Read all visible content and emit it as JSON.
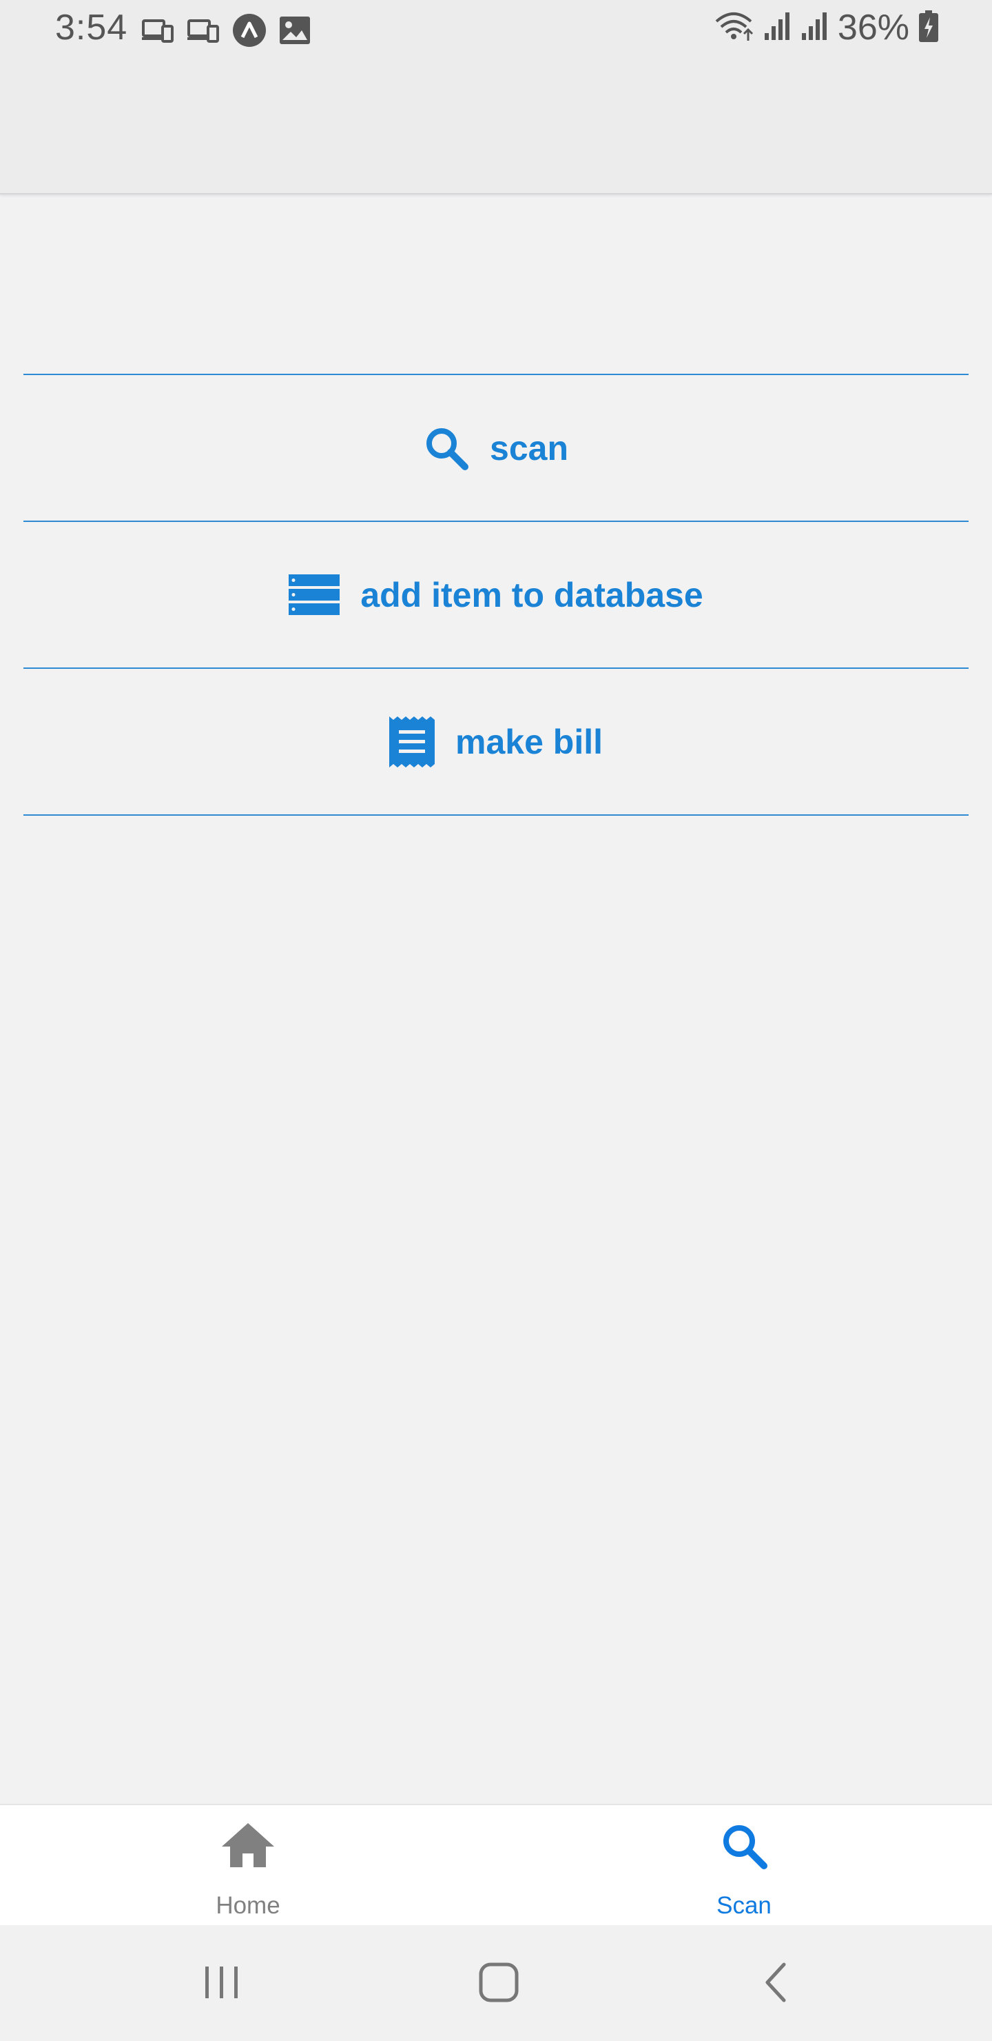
{
  "status_bar": {
    "time": "3:54",
    "battery_percent": "36%",
    "left_icons": [
      "devices-icon",
      "devices-icon",
      "expo-icon",
      "image-icon"
    ],
    "right_icons": [
      "wifi-icon",
      "signal-icon",
      "signal-icon",
      "battery-charging-icon"
    ]
  },
  "menu": {
    "items": [
      {
        "label": "scan",
        "icon": "search-icon"
      },
      {
        "label": "add item to database",
        "icon": "database-icon"
      },
      {
        "label": "make bill",
        "icon": "receipt-icon"
      }
    ]
  },
  "tabbar": {
    "tabs": [
      {
        "label": "Home",
        "icon": "home-icon",
        "active": false
      },
      {
        "label": "Scan",
        "icon": "search-icon",
        "active": true
      }
    ]
  },
  "colors": {
    "accent": "#1a83d6",
    "active_tab": "#0f7ae0",
    "inactive_tab": "#808080",
    "divider": "#2e8ad3",
    "background": "#f2f2f3"
  },
  "system_nav": {
    "buttons": [
      "recents-icon",
      "home-outline-icon",
      "back-icon"
    ]
  }
}
